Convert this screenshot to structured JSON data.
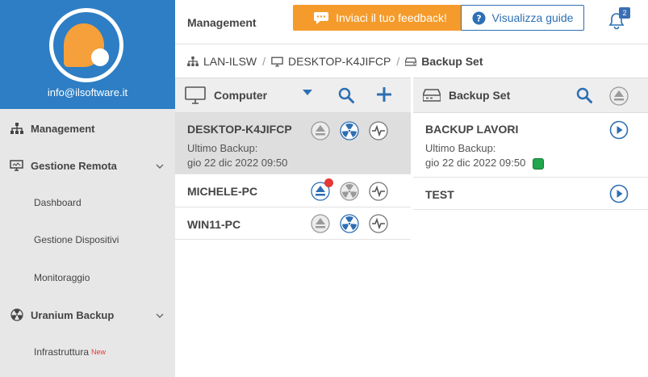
{
  "sidebar": {
    "email": "info@ilsoftware.it",
    "items": [
      {
        "label": "Management",
        "icon": "sitemap-icon"
      },
      {
        "label": "Gestione Remota",
        "icon": "monitor-icon"
      },
      {
        "label": "Dashboard"
      },
      {
        "label": "Gestione Dispositivi"
      },
      {
        "label": "Monitoraggio"
      },
      {
        "label": "Uranium Backup",
        "icon": "radiation-icon"
      },
      {
        "label": "Infrastruttura",
        "badge": "New"
      }
    ]
  },
  "topbar": {
    "title": "Management",
    "feedback_label": "Inviaci il tuo feedback!",
    "guide_label": "Visualizza guide",
    "notification_count": "2"
  },
  "breadcrumb": {
    "items": [
      "LAN-ILSW",
      "DESKTOP-K4JIFCP",
      "Backup Set"
    ]
  },
  "computers_panel": {
    "title": "Computer",
    "rows": [
      {
        "name": "DESKTOP-K4JIFCP",
        "sub1": "Ultimo Backup:",
        "sub2": "gio 22 dic 2022 09:50",
        "selected": true
      },
      {
        "name": "MICHELE-PC"
      },
      {
        "name": "WIN11-PC"
      }
    ]
  },
  "backupset_panel": {
    "title": "Backup Set",
    "rows": [
      {
        "name": "BACKUP LAVORI",
        "sub1": "Ultimo Backup:",
        "sub2": "gio 22 dic 2022 09:50",
        "status_color": "#21a54d"
      },
      {
        "name": "TEST"
      }
    ]
  },
  "colors": {
    "brand_blue": "#2d7ec4",
    "accent_orange": "#f59b2b",
    "link_blue": "#2d6fb3",
    "alert_red": "#e53935",
    "ok_green": "#21a54d"
  }
}
